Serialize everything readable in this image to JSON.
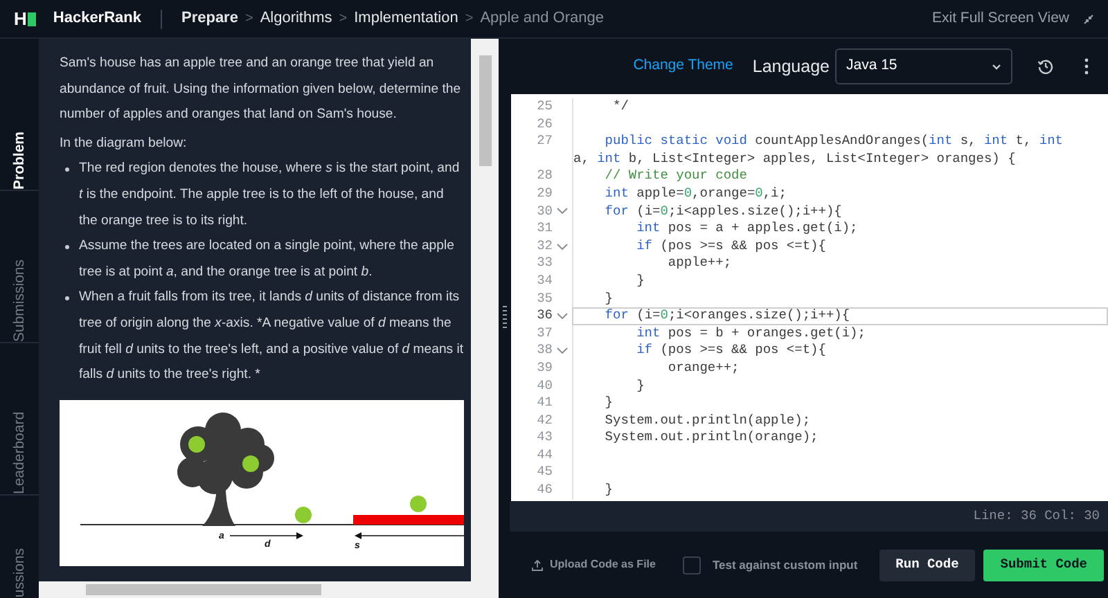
{
  "header": {
    "logo": "H",
    "brand": "HackerRank",
    "breadcrumbs": [
      {
        "label": "Prepare",
        "current": false,
        "bold": true
      },
      {
        "label": "Algorithms",
        "current": false,
        "bold": false
      },
      {
        "label": "Implementation",
        "current": false,
        "bold": false
      },
      {
        "label": "Apple and Orange",
        "current": true,
        "bold": false
      }
    ],
    "breadcrumb_separator": ">",
    "exit_label": "Exit Full Screen View"
  },
  "side_tabs": [
    {
      "label": "Problem",
      "selected": true
    },
    {
      "label": "Submissions",
      "selected": false
    },
    {
      "label": "Leaderboard",
      "selected": false
    },
    {
      "label": "ussions",
      "selected": false
    }
  ],
  "problem": {
    "paragraphs": [
      "Sam's house has an apple tree and an orange tree that yield an abundance of fruit. Using the information given below, determine the number of apples and oranges that land on Sam's house.",
      "In the diagram below:"
    ],
    "bullets": [
      "The red region denotes the house, where *s* is the start point, and *t* is the endpoint. The apple tree is to the left of the house, and the orange tree is to its right.",
      "Assume the trees are located on a single point, where the apple tree is at point *a*, and the orange tree is at point *b*.",
      "When a fruit falls from its tree, it lands *d* units of distance from its tree of origin along the *x*-axis. *A negative value of *d* means the fruit fell *d* units to the tree's left, and a positive value of *d* means it falls *d* units to the tree's right. *"
    ],
    "diagram_labels": [
      "a",
      "d",
      "s"
    ]
  },
  "toolbar": {
    "theme_link": "Change Theme",
    "language_label": "Language",
    "language": "Java 15"
  },
  "code_lines": [
    {
      "number": "25",
      "fold": false,
      "current": false,
      "tokens": [
        {
          "kind": "plain",
          "text": "     */"
        }
      ]
    },
    {
      "number": "26",
      "fold": false,
      "current": false
    },
    {
      "number": "27",
      "fold": false,
      "current": false,
      "tokens": [
        {
          "kind": "keyword",
          "text": "    public static void"
        },
        {
          "kind": "plain",
          "text": " countApplesAndOranges("
        },
        {
          "kind": "keyword",
          "text": "int"
        },
        {
          "kind": "plain",
          "text": " s, "
        },
        {
          "kind": "keyword",
          "text": "int"
        },
        {
          "kind": "plain",
          "text": " t, "
        },
        {
          "kind": "keyword",
          "text": "int"
        }
      ]
    },
    {
      "fold": false,
      "current": false,
      "tokens": [
        {
          "kind": "plain",
          "text": "a, "
        },
        {
          "kind": "keyword",
          "text": "int"
        },
        {
          "kind": "plain",
          "text": " b, List<Integer> apples, List<Integer> oranges) {"
        }
      ]
    },
    {
      "number": "28",
      "fold": false,
      "current": false,
      "tokens": [
        {
          "kind": "comment",
          "text": "    // Write your code"
        }
      ]
    },
    {
      "number": "29",
      "fold": false,
      "current": false,
      "tokens": [
        {
          "kind": "keyword",
          "text": "    int"
        },
        {
          "kind": "plain",
          "text": " apple="
        },
        {
          "kind": "number",
          "text": "0"
        },
        {
          "kind": "plain",
          "text": ",orange="
        },
        {
          "kind": "number",
          "text": "0"
        },
        {
          "kind": "plain",
          "text": ",i;"
        }
      ]
    },
    {
      "number": "30",
      "fold": true,
      "current": false,
      "tokens": [
        {
          "kind": "keyword",
          "text": "    for"
        },
        {
          "kind": "plain",
          "text": " (i="
        },
        {
          "kind": "number",
          "text": "0"
        },
        {
          "kind": "plain",
          "text": ";i<apples.size();i++){"
        }
      ]
    },
    {
      "number": "31",
      "fold": false,
      "current": false,
      "tokens": [
        {
          "kind": "keyword",
          "text": "        int"
        },
        {
          "kind": "plain",
          "text": " pos = a + apples.get(i);"
        }
      ]
    },
    {
      "number": "32",
      "fold": true,
      "current": false,
      "tokens": [
        {
          "kind": "keyword",
          "text": "        if"
        },
        {
          "kind": "plain",
          "text": " (pos >=s && pos <=t){"
        }
      ]
    },
    {
      "number": "33",
      "fold": false,
      "current": false,
      "tokens": [
        {
          "kind": "plain",
          "text": "            apple++;"
        }
      ]
    },
    {
      "number": "34",
      "fold": false,
      "current": false,
      "tokens": [
        {
          "kind": "plain",
          "text": "        }"
        }
      ]
    },
    {
      "number": "35",
      "fold": false,
      "current": false,
      "tokens": [
        {
          "kind": "plain",
          "text": "    }"
        }
      ]
    },
    {
      "number": "36",
      "fold": true,
      "current": true,
      "tokens": [
        {
          "kind": "keyword",
          "text": "    for"
        },
        {
          "kind": "plain",
          "text": " (i="
        },
        {
          "kind": "number",
          "text": "0"
        },
        {
          "kind": "plain",
          "text": ";i<oranges.size();i++){"
        }
      ]
    },
    {
      "number": "37",
      "fold": false,
      "current": false,
      "tokens": [
        {
          "kind": "keyword",
          "text": "        int"
        },
        {
          "kind": "plain",
          "text": " pos = b + oranges.get(i);"
        }
      ]
    },
    {
      "number": "38",
      "fold": true,
      "current": false,
      "tokens": [
        {
          "kind": "keyword",
          "text": "        if"
        },
        {
          "kind": "plain",
          "text": " (pos >=s && pos <=t){"
        }
      ]
    },
    {
      "number": "39",
      "fold": false,
      "current": false,
      "tokens": [
        {
          "kind": "plain",
          "text": "            orange++;"
        }
      ]
    },
    {
      "number": "40",
      "fold": false,
      "current": false,
      "tokens": [
        {
          "kind": "plain",
          "text": "        }"
        }
      ]
    },
    {
      "number": "41",
      "fold": false,
      "current": false,
      "tokens": [
        {
          "kind": "plain",
          "text": "    }"
        }
      ]
    },
    {
      "number": "42",
      "fold": false,
      "current": false,
      "tokens": [
        {
          "kind": "plain",
          "text": "    System.out.println(apple);"
        }
      ]
    },
    {
      "number": "43",
      "fold": false,
      "current": false,
      "tokens": [
        {
          "kind": "plain",
          "text": "    System.out.println(orange);"
        }
      ]
    },
    {
      "number": "44",
      "fold": false,
      "current": false
    },
    {
      "number": "45",
      "fold": false,
      "current": false
    },
    {
      "number": "46",
      "fold": false,
      "current": false,
      "tokens": [
        {
          "kind": "plain",
          "text": "    }"
        }
      ]
    }
  ],
  "status_bar": "Line: 36 Col: 30",
  "footer": {
    "upload": "Upload Code as File",
    "custom_input": {
      "label": "Test against custom input",
      "checked": false
    },
    "run": "Run Code",
    "submit": "Submit Code"
  }
}
